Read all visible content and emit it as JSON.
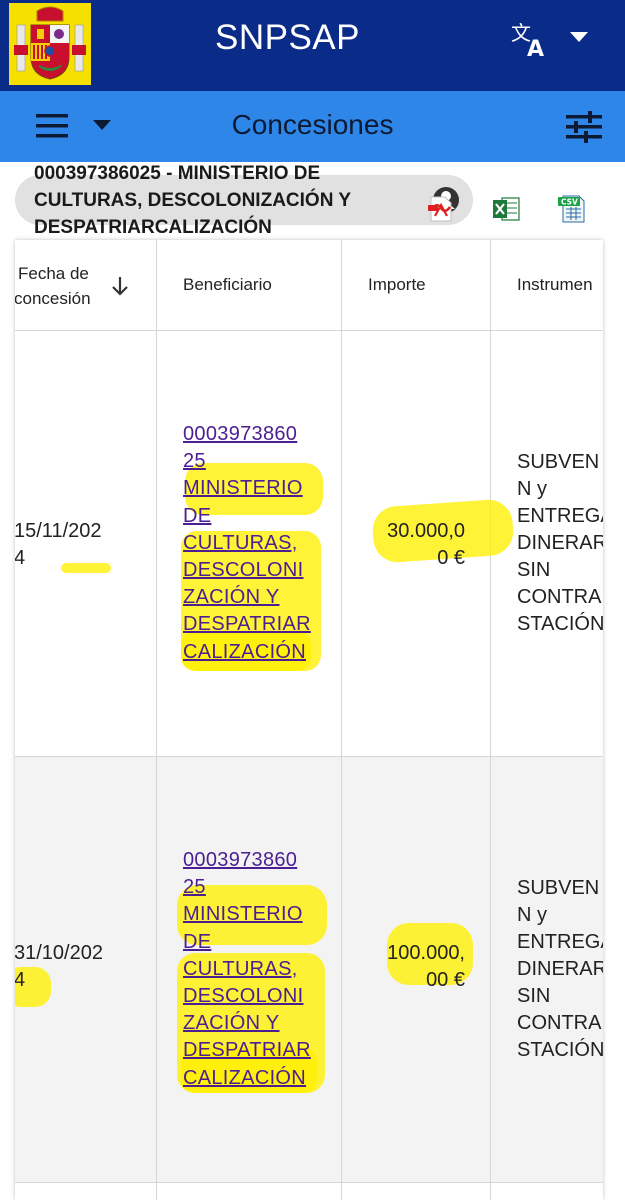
{
  "app": {
    "title": "SNPSAP",
    "logo_icon": "spain-coat-of-arms-icon",
    "translate_icon": "translate-icon",
    "language_menu_icon": "chevron-down-icon"
  },
  "toolbar": {
    "title": "Concesiones",
    "menu_icon": "hamburger-icon",
    "menu_caret_icon": "chevron-down-icon",
    "filter_icon": "tune-icon"
  },
  "entity_filter": {
    "lines": [
      "000397386025 - MINISTERIO DE",
      "CULTURAS, DESCOLONIZACIÓN Y",
      "DESPATRIARCALIZACIÓN"
    ],
    "avatar_icon": "avatar-icon"
  },
  "exports": {
    "pdf_icon": "pdf-icon",
    "excel_icon": "excel-icon",
    "csv_icon": "csv-icon"
  },
  "table": {
    "headers": {
      "fecha": [
        "Fecha de",
        "concesión"
      ],
      "sort_icon": "arrow-down-icon",
      "beneficiario": "Beneficiario",
      "importe": "Importe",
      "instrumento": "Instrumen"
    },
    "rows": [
      {
        "fecha": [
          "15/11/202",
          "4"
        ],
        "beneficiario": [
          "0003973860",
          "25",
          "MINISTERIO",
          "DE",
          "CULTURAS,",
          "DESCOLONI",
          "ZACIÓN Y",
          "DESPATRIAR",
          "CALIZACIÓN"
        ],
        "importe": [
          "30.000,0",
          "0 €"
        ],
        "instrumento": [
          "SUBVEN",
          "N y",
          "ENTREGA",
          "DINERAR",
          "SIN",
          "CONTRA",
          "STACIÓN"
        ]
      },
      {
        "fecha": [
          "31/10/202",
          "4"
        ],
        "beneficiario": [
          "0003973860",
          "25",
          "MINISTERIO",
          "DE",
          "CULTURAS,",
          "DESCOLONI",
          "ZACIÓN Y",
          "DESPATRIAR",
          "CALIZACIÓN"
        ],
        "importe": [
          "100.000,",
          "00 €"
        ],
        "instrumento": [
          "SUBVEN",
          "N y",
          "ENTREGA",
          "DINERAR",
          "SIN",
          "CONTRA",
          "STACIÓN"
        ]
      }
    ]
  },
  "colors": {
    "top_bar": "#0a2c88",
    "sub_bar": "#2e87e8",
    "link": "#4b1e91",
    "highlight": "#fff000"
  }
}
